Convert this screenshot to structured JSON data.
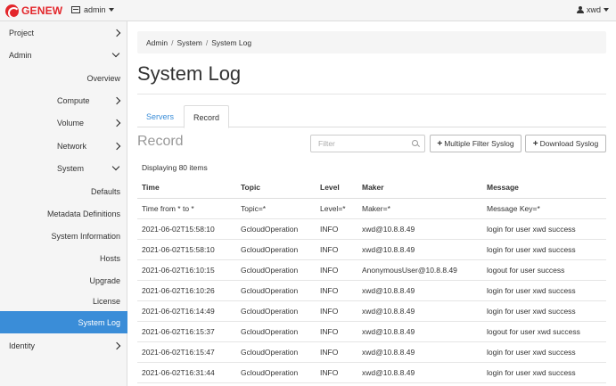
{
  "header": {
    "logo_text": "GENEW",
    "project": "admin",
    "user": "xwd"
  },
  "sidebar": {
    "items": [
      {
        "label": "Project"
      },
      {
        "label": "Admin"
      },
      {
        "label": "Overview"
      },
      {
        "label": "Compute"
      },
      {
        "label": "Volume"
      },
      {
        "label": "Network"
      },
      {
        "label": "System"
      },
      {
        "label": "Defaults"
      },
      {
        "label": "Metadata Definitions"
      },
      {
        "label": "System Information"
      },
      {
        "label": "Hosts"
      },
      {
        "label": "Upgrade"
      },
      {
        "label": "License"
      },
      {
        "label": "System Log"
      },
      {
        "label": "Identity"
      }
    ],
    "active": "System Log"
  },
  "breadcrumb": [
    "Admin",
    "System",
    "System Log"
  ],
  "page_title": "System Log",
  "tabs": [
    {
      "label": "Servers"
    },
    {
      "label": "Record",
      "active": true
    }
  ],
  "section_title": "Record",
  "filter": {
    "placeholder": "Filter"
  },
  "buttons": {
    "multi_filter": "Multiple Filter Syslog",
    "download": "Download Syslog"
  },
  "count_text": "Displaying 80 items",
  "table": {
    "columns": [
      "Time",
      "Topic",
      "Level",
      "Maker",
      "Message"
    ],
    "filter_row": [
      "Time from * to *",
      "Topic=*",
      "Level=*",
      "Maker=*",
      "Message Key=*"
    ],
    "rows": [
      [
        "2021-06-02T15:58:10",
        "GcloudOperation",
        "INFO",
        "xwd@10.8.8.49",
        "login for user xwd success"
      ],
      [
        "2021-06-02T15:58:10",
        "GcloudOperation",
        "INFO",
        "xwd@10.8.8.49",
        "login for user xwd success"
      ],
      [
        "2021-06-02T16:10:15",
        "GcloudOperation",
        "INFO",
        "AnonymousUser@10.8.8.49",
        "logout for user success"
      ],
      [
        "2021-06-02T16:10:26",
        "GcloudOperation",
        "INFO",
        "xwd@10.8.8.49",
        "login for user xwd success"
      ],
      [
        "2021-06-02T16:14:49",
        "GcloudOperation",
        "INFO",
        "xwd@10.8.8.49",
        "login for user xwd success"
      ],
      [
        "2021-06-02T16:15:37",
        "GcloudOperation",
        "INFO",
        "xwd@10.8.8.49",
        "logout for user xwd success"
      ],
      [
        "2021-06-02T16:15:47",
        "GcloudOperation",
        "INFO",
        "xwd@10.8.8.49",
        "login for user xwd success"
      ],
      [
        "2021-06-02T16:31:44",
        "GcloudOperation",
        "INFO",
        "xwd@10.8.8.49",
        "login for user xwd success"
      ]
    ]
  },
  "colors": {
    "brand": "#e3262b",
    "accent": "#3a8dd8",
    "sidebar_bg": "#f5f5f5"
  }
}
